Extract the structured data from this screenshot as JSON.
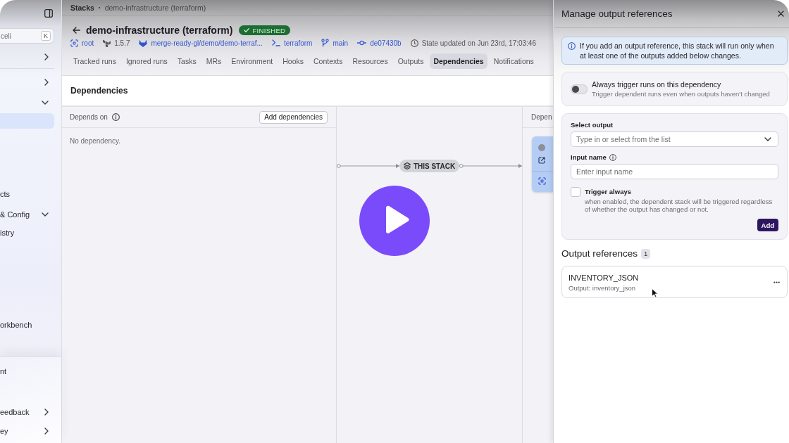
{
  "sidebar": {
    "search": {
      "placeholder": "celi",
      "shortcut": "K"
    },
    "groups": [
      {
        "items": [
          {
            "kind": "group",
            "expanded": false,
            "selected": false
          }
        ]
      },
      {
        "items": [
          {
            "kind": "group",
            "expanded": false,
            "selected": false
          },
          {
            "kind": "group",
            "expanded": true,
            "selected": false
          },
          {
            "kind": "link",
            "selected": true
          },
          {
            "kind": "link",
            "label": "cts",
            "selected": false
          },
          {
            "kind": "group",
            "label": "& Config",
            "expanded": true,
            "selected": false
          },
          {
            "kind": "link",
            "label": "istry",
            "selected": false
          },
          {
            "kind": "link",
            "label": "orkbench",
            "selected": false
          }
        ]
      }
    ],
    "bottom_items": [
      {
        "kind": "link",
        "label": "nt",
        "selected": false
      },
      {
        "kind": "group",
        "label": "eedback",
        "expanded": false,
        "selected": false
      },
      {
        "kind": "group",
        "label": "ey",
        "expanded": false,
        "selected": false
      }
    ]
  },
  "breadcrumb": {
    "items": [
      "Stacks",
      "demo-infrastructure (terraform)"
    ],
    "separator": "•"
  },
  "header": {
    "title": "demo-infrastructure (terraform)",
    "status": {
      "kind": "success",
      "text": "FINISHED"
    },
    "meta": [
      {
        "kind": "space",
        "text": "root"
      },
      {
        "kind": "version",
        "text": "1.5.7"
      },
      {
        "kind": "repository",
        "text": "merge-ready-gl/demo/demo-terraf..."
      },
      {
        "kind": "project",
        "text": "terraform"
      },
      {
        "kind": "branch",
        "text": "main"
      },
      {
        "kind": "commit",
        "text": "de07430b"
      },
      {
        "kind": "updated",
        "text": "State updated on Jun 23rd, 17:03:46"
      }
    ]
  },
  "tabs": [
    {
      "label": "Tracked runs",
      "selected": false
    },
    {
      "label": "Ignored runs",
      "selected": false
    },
    {
      "label": "Tasks",
      "selected": false
    },
    {
      "label": "MRs",
      "selected": false
    },
    {
      "label": "Environment",
      "selected": false
    },
    {
      "label": "Hooks",
      "selected": false
    },
    {
      "label": "Contexts",
      "selected": false
    },
    {
      "label": "Resources",
      "selected": false
    },
    {
      "label": "Outputs",
      "selected": false
    },
    {
      "label": "Dependencies",
      "selected": true
    },
    {
      "label": "Notifications",
      "selected": false
    }
  ],
  "dependencies": {
    "title": "Dependencies",
    "depends_on": {
      "title": "Depends on",
      "button": "Add dependencies",
      "empty_text": "No dependency."
    },
    "graph": {
      "node": "THIS STACK"
    },
    "column_3": {
      "title": "Depen"
    }
  },
  "drawer": {
    "title": "Manage output references",
    "notice": "If you add an output reference, this stack will run only when at least one of the outputs added below changes.",
    "toggle": {
      "label": "Always trigger runs on this dependency",
      "description": "Trigger dependent runs even when outputs haven't changed",
      "on": false
    },
    "form": {
      "select": {
        "label": "Select output",
        "placeholder": "Type in or select from the list"
      },
      "input": {
        "label": "Input name",
        "placeholder": "Enter input name"
      },
      "checkbox": {
        "label": "Trigger always",
        "description": "when enabled, the dependent stack will be triggered regardless of whether the output has changed or not.",
        "checked": false
      },
      "button": "Add"
    },
    "references": {
      "title": "Output references",
      "count": "1",
      "items": [
        {
          "name": "INVENTORY_JSON",
          "detail": "Output: inventory_json"
        }
      ]
    }
  }
}
